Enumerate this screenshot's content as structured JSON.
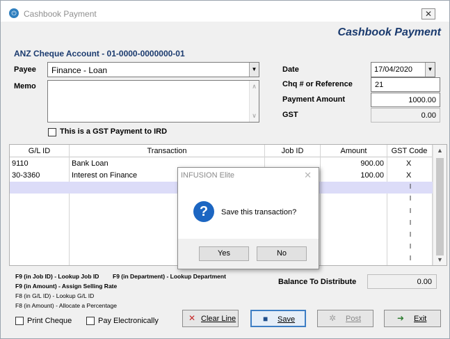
{
  "window": {
    "title": "Cashbook Payment",
    "app_icon": "power-icon",
    "close_label": "✕"
  },
  "header": {
    "title": "Cashbook Payment",
    "account": "ANZ Cheque Account - 01-0000-0000000-01"
  },
  "form": {
    "payee_label": "Payee",
    "payee_value": "Finance - Loan",
    "memo_label": "Memo",
    "memo_value": "",
    "gst_checkbox_label": "This is a GST Payment to IRD",
    "gst_checkbox_checked": false,
    "date_label": "Date",
    "date_value": "17/04/2020",
    "chq_label": "Chq # or Reference",
    "chq_value": "21",
    "payment_label": "Payment Amount",
    "payment_value": "1000.00",
    "gst_label": "GST",
    "gst_value": "0.00"
  },
  "grid": {
    "columns": [
      "G/L ID",
      "Transaction",
      "Job ID",
      "Amount",
      "GST Code"
    ],
    "rows": [
      {
        "gl_id": "9110",
        "transaction": "Bank Loan",
        "job_id": "",
        "amount": "900.00",
        "gst_code": "X"
      },
      {
        "gl_id": "30-3360",
        "transaction": "Interest on Finance",
        "job_id": "",
        "amount": "100.00",
        "gst_code": "X"
      }
    ],
    "gst_marks": [
      "I",
      "I",
      "I",
      "I",
      "I",
      "I",
      "I"
    ]
  },
  "dialog": {
    "title": "INFUSION Elite",
    "message": "Save this transaction?",
    "yes_label": "Yes",
    "no_label": "No",
    "icon": "question-icon"
  },
  "hints": {
    "line1_a": "F9 (in Job ID) - Lookup Job ID",
    "line1_b": "F9 (in Department) - Lookup Department",
    "line2": "F9 (in Amount) - Assign Selling Rate",
    "line3": "F8 (in G/L ID) - Lookup G/L ID",
    "line4": "F8 (in Amount) - Allocate a Percentage"
  },
  "balance": {
    "label": "Balance To Distribute",
    "value": "0.00"
  },
  "bottom": {
    "print_cheque_label": "Print Cheque",
    "pay_electronically_label": "Pay Electronically",
    "clear_line_label": "Clear Line",
    "save_label": "Save",
    "post_label": "Post",
    "exit_label": "Exit"
  },
  "colors": {
    "accent": "#1a3a6e",
    "selected_row": "#dcdcf8",
    "dialog_icon": "#1c66c2"
  }
}
